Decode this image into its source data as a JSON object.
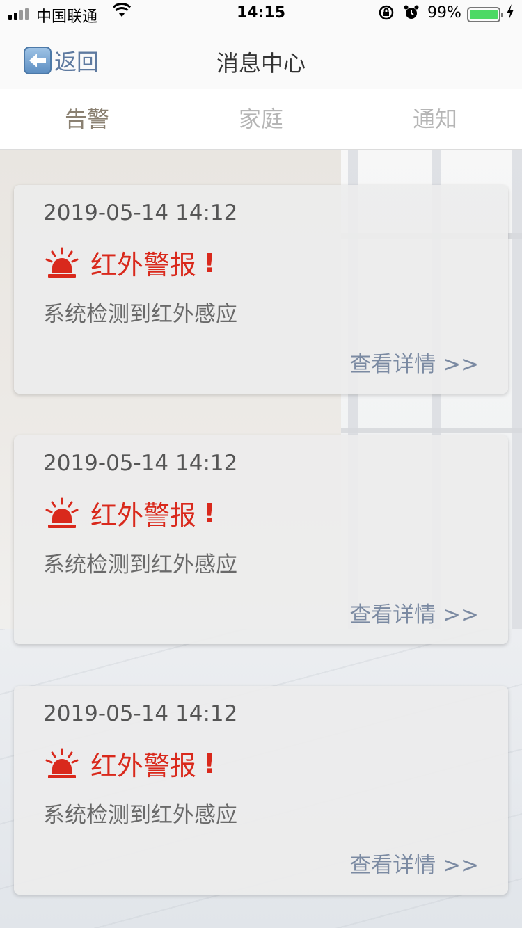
{
  "status_bar": {
    "carrier": "中国联通",
    "time": "14:15",
    "battery_percent": "99%",
    "battery_level": 0.99,
    "icons": [
      "signal-icon",
      "wifi-icon",
      "rotation-lock-icon",
      "alarm-icon",
      "battery-icon",
      "charging-icon"
    ]
  },
  "nav": {
    "back_label": "返回",
    "title": "消息中心"
  },
  "tabs": [
    {
      "label": "告警",
      "active": true
    },
    {
      "label": "家庭",
      "active": false
    },
    {
      "label": "通知",
      "active": false
    }
  ],
  "cards": [
    {
      "time": "2019-05-14 14:12",
      "title": "红外警报",
      "mark": "!",
      "description": "系统检测到红外感应",
      "link": "查看详情 >>"
    },
    {
      "time": "2019-05-14 14:12",
      "title": "红外警报",
      "mark": "!",
      "description": "系统检测到红外感应",
      "link": "查看详情 >>"
    },
    {
      "time": "2019-05-14 14:12",
      "title": "红外警报",
      "mark": "!",
      "description": "系统检测到红外感应",
      "link": "查看详情 >>"
    }
  ],
  "colors": {
    "alert_red": "#d9291c",
    "link": "#7b8aa2",
    "active_tab": "#8a8071",
    "inactive_tab": "#b5b5b5"
  }
}
